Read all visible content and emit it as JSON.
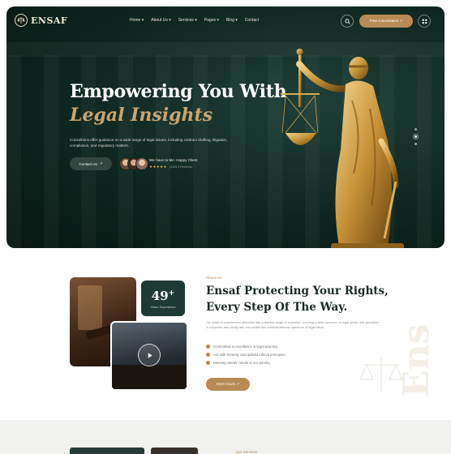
{
  "brand": {
    "name": "ENSAF",
    "tagline": "",
    "accent_color": "#b88a55",
    "dark_color": "#0f2620"
  },
  "nav": {
    "items": [
      {
        "label": "Home ▾"
      },
      {
        "label": "About Us ▾"
      },
      {
        "label": "Services ▾"
      },
      {
        "label": "Pages ▾"
      },
      {
        "label": "Blog ▾"
      },
      {
        "label": "Contact"
      }
    ],
    "cta_label": "Free Consultation ↗",
    "search_icon": "search-icon",
    "menu_icon": "grid-icon"
  },
  "hero": {
    "title_line1": "Empowering You With",
    "title_line2": "Legal Insights",
    "description": "Consultions offer guidance on a wide range of legal issues, including contract drafting, litigation, compliance, and regulatory matters.",
    "contact_label": "Contact Us",
    "happy_clients": "We have to 5k+ Happy Client",
    "stars": "★★★★★",
    "reviews": "(4.8/5.0 Reviews)"
  },
  "about": {
    "tag": "About Us",
    "title_line1": "Ensaf Protecting Your Rights,",
    "title_line2": "Every Step Of The Way.",
    "description": "Our team of experienced attorneys has a diverse range of expertise, covering a wide spectrum of legal areas. We specialize in corporate law, family law, real estate law, criminal defense spectrum of legal areas.",
    "stat_number": "49",
    "stat_suffix": "+",
    "stat_label": "Years Experience",
    "bullets": [
      {
        "text": "Committed to excellence & legal practice."
      },
      {
        "text": "Act with honesty and uphold ethical principles."
      },
      {
        "text": "Meeting clients' needs is our priority."
      }
    ],
    "button_label": "More Hours ↗",
    "watermark": "Ens"
  },
  "next_section": {
    "tag": "Our Services"
  }
}
